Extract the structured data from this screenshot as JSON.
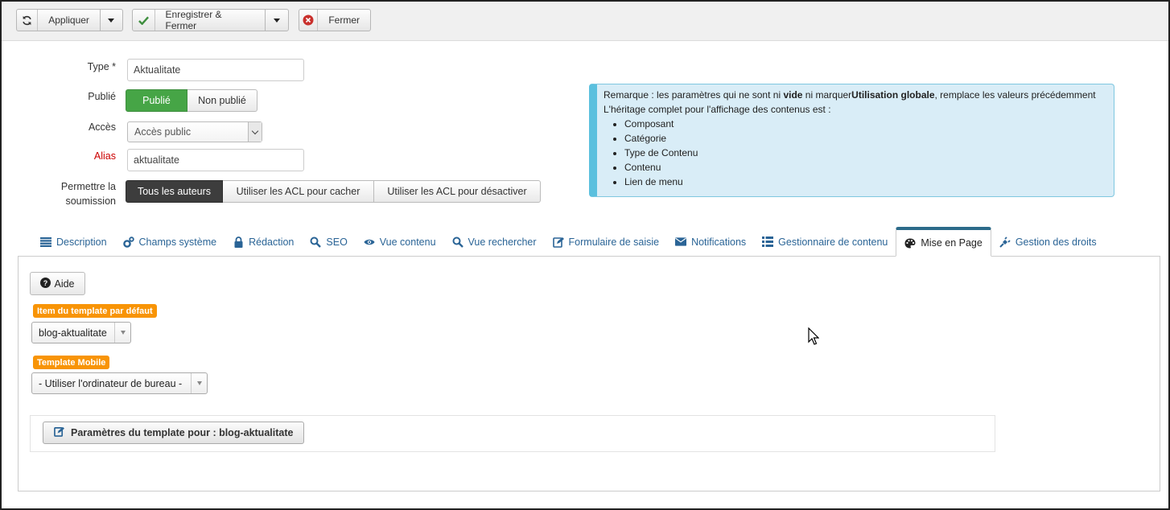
{
  "toolbar": {
    "apply_label": "Appliquer",
    "save_close_label": "Enregistrer & Fermer",
    "close_label": "Fermer"
  },
  "form": {
    "type_label": "Type *",
    "type_value": "Aktualitate",
    "published_label": "Publié",
    "published_options": [
      "Publié",
      "Non publié"
    ],
    "published_selected": "Publié",
    "access_label": "Accès",
    "access_value": "Accès public",
    "alias_label": "Alias",
    "alias_value": "aktualitate",
    "submission_label_line1": "Permettre la",
    "submission_label_line2": "soumission",
    "submission_options": [
      "Tous les auteurs",
      "Utiliser les ACL pour cacher",
      "Utiliser les ACL pour désactiver"
    ],
    "submission_selected": "Tous les auteurs"
  },
  "note": {
    "line1_a": "Remarque : les paramètres qui ne sont ni ",
    "line1_b": "vide",
    "line1_c": " ni marquer",
    "line1_d": "Utilisation globale",
    "line1_e": ", remplace les valeurs précédemment",
    "line2": "L'héritage complet pour l'affichage des contenus est :",
    "items": [
      "Composant",
      "Catégorie",
      "Type de Contenu",
      "Contenu",
      "Lien de menu"
    ]
  },
  "tabs": [
    {
      "label": "Description",
      "icon": "list-icon"
    },
    {
      "label": "Champs système",
      "icon": "cogs-icon"
    },
    {
      "label": "Rédaction",
      "icon": "lock-icon"
    },
    {
      "label": "SEO",
      "icon": "search-icon"
    },
    {
      "label": "Vue contenu",
      "icon": "eye-icon"
    },
    {
      "label": "Vue rechercher",
      "icon": "search-icon"
    },
    {
      "label": "Formulaire de saisie",
      "icon": "edit-icon"
    },
    {
      "label": "Notifications",
      "icon": "envelope-icon"
    },
    {
      "label": "Gestionnaire de contenu",
      "icon": "list-view-icon"
    },
    {
      "label": "Mise en Page",
      "icon": "palette-icon"
    },
    {
      "label": "Gestion des droits",
      "icon": "plug-icon"
    }
  ],
  "active_tab": "Mise en Page",
  "layout_panel": {
    "help_label": "Aide",
    "default_template_label": "Item du template par défaut",
    "default_template_value": "blog-aktualitate",
    "mobile_template_label": "Template Mobile",
    "mobile_template_value": "- Utiliser l'ordinateur de bureau -",
    "template_params_button": "Paramètres du template pour : blog-aktualitate"
  },
  "colors": {
    "green": "#46a546",
    "dark": "#3d3d3d",
    "info_bg": "#d9edf7",
    "info_border": "#5bc0de",
    "badge_orange": "#f89406",
    "link_blue": "#2a6496"
  }
}
